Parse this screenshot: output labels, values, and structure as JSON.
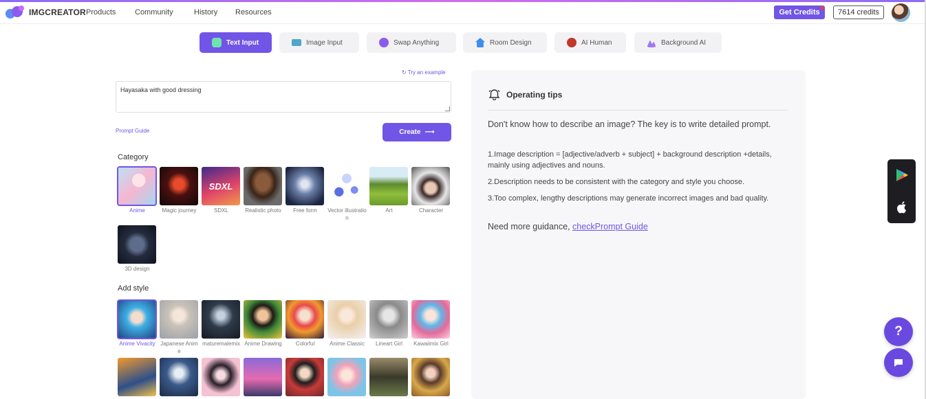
{
  "header": {
    "logo_text": "IMGCREATOR",
    "nav": [
      "Products",
      "Community",
      "History",
      "Resources"
    ],
    "get_credits": "Get Credits",
    "credits": "7614 credits"
  },
  "tabs": [
    "Text Input",
    "Image Input",
    "Swap Anything",
    "Room Design",
    "AI Human",
    "Background AI"
  ],
  "form": {
    "try_example": "Try an example",
    "prompt_value": "Hayasaka with good dressing",
    "prompt_guide": "Prompt Guide",
    "create": "Create"
  },
  "category": {
    "title": "Category",
    "items": [
      "Anime",
      "Magic journey",
      "SDXL",
      "Realistic photo",
      "Free form",
      "Vector illustration",
      "Art",
      "Character",
      "3D design"
    ]
  },
  "style": {
    "title": "Add style",
    "items": [
      "Anime Vivacity",
      "Japanese Anime",
      "maturemalemix",
      "Anime Drawing",
      "Colorful",
      "Anime Classic",
      "Lineart Girl",
      "Kawaiimix Girl"
    ]
  },
  "tips": {
    "title": "Operating tips",
    "intro": "Don't know how to describe an image? The key is to write detailed prompt.",
    "p1": "1.Image description = [adjective/adverb + subject] + background description +details, mainly using adjectives and nouns.",
    "p2": "2.Description needs to be consistent with the category and style you choose.",
    "p3": "3.Too complex, lengthy descriptions may generate incorrect images and bad quality.",
    "guidance": "Need more guidance, ",
    "guidance_link": "checkPrompt Guide"
  },
  "colors": {
    "accent": "#7155e6",
    "panel": "#f7f7f9"
  }
}
